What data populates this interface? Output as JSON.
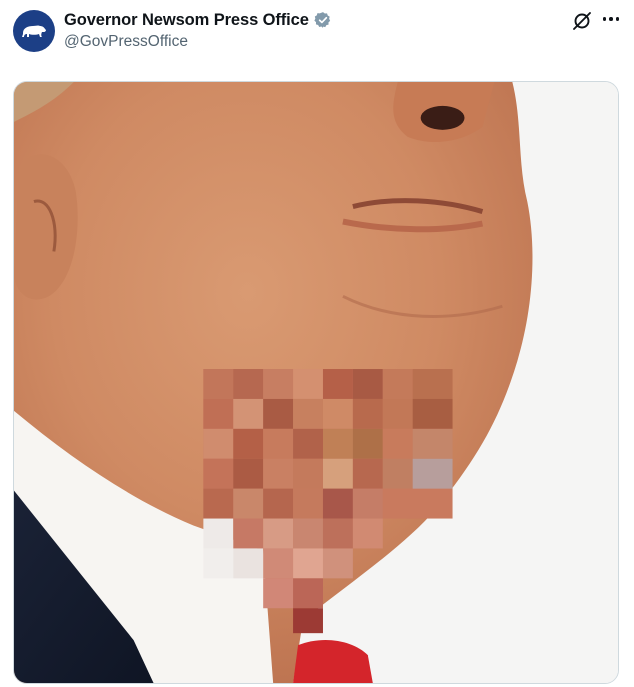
{
  "post": {
    "author": {
      "display_name": "Governor Newsom Press Office",
      "handle": "@GovPressOffice",
      "verified": true,
      "avatar_icon": "california-bear-icon",
      "avatar_color": "#1c3f86"
    },
    "actions": {
      "grok_icon": "grok-icon",
      "more_icon": "more-options-icon"
    },
    "media": {
      "type": "photo",
      "pixelated_region": true
    }
  },
  "colors": {
    "text": "#0f1419",
    "secondary_text": "#536471",
    "verified_badge": "#829aab",
    "border": "#cfd9de"
  }
}
